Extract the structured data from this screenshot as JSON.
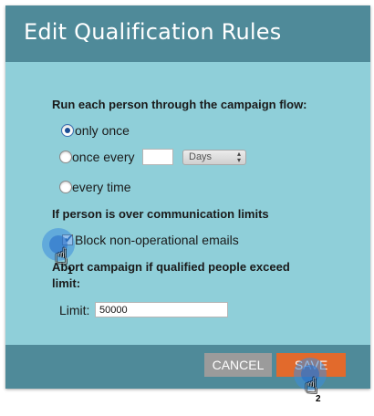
{
  "dialog": {
    "title": "Edit Qualification Rules"
  },
  "flow": {
    "heading": "Run each person through the campaign flow:",
    "options": [
      {
        "label": "only once",
        "checked": true
      },
      {
        "label": "once every",
        "checked": false
      },
      {
        "label": "every time",
        "checked": false
      }
    ],
    "interval_value": "",
    "interval_unit": "Days"
  },
  "limits": {
    "heading": "If person is over communication limits",
    "block_label": "Block non-operational emails",
    "block_checked": true
  },
  "abort": {
    "heading_line1": "Abort campaign if qualified people exceed",
    "heading_line2": "limit:",
    "limit_label": "Limit:",
    "limit_value": "50000"
  },
  "footer": {
    "cancel_label": "CANCEL",
    "save_label": "SAVE"
  },
  "hints": {
    "step1": "1",
    "step2": "2"
  },
  "colors": {
    "header": "#4f8a99",
    "body": "#8fcfd9",
    "save": "#e26a2c",
    "cancel": "#9b9b9b"
  }
}
